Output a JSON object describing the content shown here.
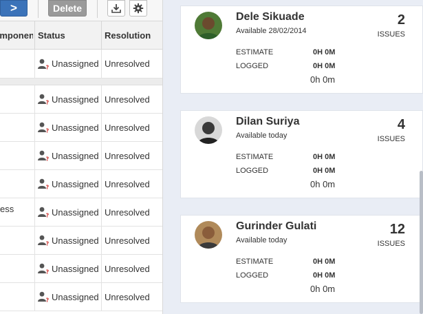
{
  "toolbar": {
    "next_label": ">",
    "delete_label": "Delete",
    "icons": [
      "download-icon",
      "gear-icon"
    ]
  },
  "table": {
    "columns": [
      "Components",
      "Status",
      "Resolution"
    ],
    "first_row": {
      "status": "Unassigned",
      "resolution": "Unresolved"
    },
    "rows": [
      {
        "component": "",
        "status": "Unassigned",
        "resolution": "Unresolved"
      },
      {
        "component": "",
        "status": "Unassigned",
        "resolution": "Unresolved"
      },
      {
        "component": "",
        "status": "Unassigned",
        "resolution": "Unresolved"
      },
      {
        "component": "",
        "status": "Unassigned",
        "resolution": "Unresolved"
      },
      {
        "component": "ess",
        "status": "Unassigned",
        "resolution": "Unresolved"
      },
      {
        "component": "",
        "status": "Unassigned",
        "resolution": "Unresolved"
      },
      {
        "component": "",
        "status": "Unassigned",
        "resolution": "Unresolved"
      },
      {
        "component": "",
        "status": "Unassigned",
        "resolution": "Unresolved"
      }
    ]
  },
  "workload": {
    "labels": {
      "issues": "ISSUES",
      "estimate": "ESTIMATE",
      "logged": "LOGGED"
    },
    "people": [
      {
        "name": "Dele Sikuade",
        "availability": "Available 28/02/2014",
        "issue_count": "2",
        "estimate": "0H 0M",
        "logged": "0H 0M",
        "remaining": "0h 0m"
      },
      {
        "name": "Dilan Suriya",
        "availability": "Available today",
        "issue_count": "4",
        "estimate": "0H 0M",
        "logged": "0H 0M",
        "remaining": "0h 0m"
      },
      {
        "name": "Gurinder Gulati",
        "availability": "Available today",
        "issue_count": "12",
        "estimate": "0H 0M",
        "logged": "0H 0M",
        "remaining": "0h 0m"
      }
    ]
  },
  "colors": {
    "primary_button": "#3b73b9",
    "delete_button": "#9a9a9a",
    "right_pane_bg": "#e9edf5"
  }
}
